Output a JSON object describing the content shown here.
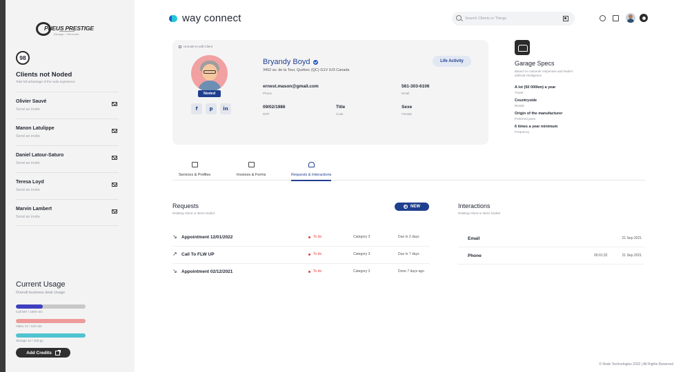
{
  "sidebar": {
    "brand": {
      "name": "PNEUS PRESTIGE",
      "tagline": "Garage • Services",
      "lettering": "DISTRIBUTEUR"
    },
    "score": "98",
    "title": "Clients not Noded",
    "subtitle": "Take full advantage of the node experience",
    "clients": [
      {
        "name": "Olivier Sauvé",
        "action": "Send an invite"
      },
      {
        "name": "Manon Latulippe",
        "action": "Send an invite"
      },
      {
        "name": "Daniel Latour-Saturo",
        "action": "Send an invite"
      },
      {
        "name": "Teresa Loyd",
        "action": "Send an invite"
      },
      {
        "name": "Marvin Lambert",
        "action": "Send an invite"
      }
    ],
    "usage": {
      "title": "Current Usage",
      "subtitle": "Overall business desk Usage",
      "bars": [
        {
          "label": "Call 587 / 1000 min",
          "fraction": 0.39,
          "color": "#3f3fbf"
        },
        {
          "label": "Video 72 / 100 min",
          "fraction": 1.0,
          "color": "#ef9a9a"
        },
        {
          "label": "Storage 12 / 100 go",
          "fraction": 1.0,
          "color": "#4fc3cf"
        }
      ],
      "button": "Add Credits"
    }
  },
  "header": {
    "app_name": "way connect",
    "search_placeholder": "Search Clients or Things"
  },
  "profile": {
    "unnode_label": "Unnode to edit Client",
    "name": "Bryandy Boyd",
    "address": "3452 av. de la Tour, Québec (QC) G1V 9J3 Canada",
    "badge": "Noded",
    "activity_button": "Life Activity",
    "social": {
      "facebook": "f",
      "pinterest": "p",
      "linkedin": "in"
    },
    "fields": {
      "email_value": "ernest.mason@gmail.com",
      "email_label": "Phone",
      "phone_value": "561-303-6106",
      "phone_label": "Email",
      "dob_value": "09/02/1986",
      "dob_label": "DOF",
      "title_value": "Title",
      "title_label": "Cook",
      "sex_value": "Sexe",
      "sex_label": "Female"
    }
  },
  "garage": {
    "title": "Garage Specs",
    "subtitle": "Based on customer responses and Node's artificial intelligence",
    "specs": [
      {
        "value": "A lot (50 000km) a year",
        "label": "Travel"
      },
      {
        "value": "Countryside",
        "label": "Reside"
      },
      {
        "value": "Origin of the manufacturer",
        "label": "Preferred parts"
      },
      {
        "value": "6 times a year minimum",
        "label": "Frequency"
      }
    ]
  },
  "tabs": [
    {
      "label": "Services & Profiles"
    },
    {
      "label": "Invoices & Forms"
    },
    {
      "label": "Requests & Interactions"
    }
  ],
  "requests": {
    "title": "Requests",
    "subtitle": "Relating Client or items Noded",
    "new_button": "NEW",
    "rows": [
      {
        "arrow": "↘",
        "title": "Appointment 12/01/2022",
        "status": "To do",
        "category": "Category 3",
        "due": "Due in 2 days"
      },
      {
        "arrow": "↗",
        "title": "Call To FLW UP",
        "status": "To do",
        "category": "Category 3",
        "due": "Due in 7 days"
      },
      {
        "arrow": "↘",
        "title": "Appointment 02/12/2021",
        "status": "To do",
        "category": "Category 3",
        "due": "Done 7 days ago"
      }
    ]
  },
  "interactions": {
    "title": "Interactions",
    "subtitle": "Relating Client or items Noded",
    "rows": [
      {
        "type": "Email",
        "duration": "",
        "date": "21 Sep 2021"
      },
      {
        "type": "Phone",
        "duration": "00:01:32",
        "date": "21 Sep 2021"
      }
    ]
  },
  "footer": "© Node Technologies 2022 | All Rights Reserved"
}
